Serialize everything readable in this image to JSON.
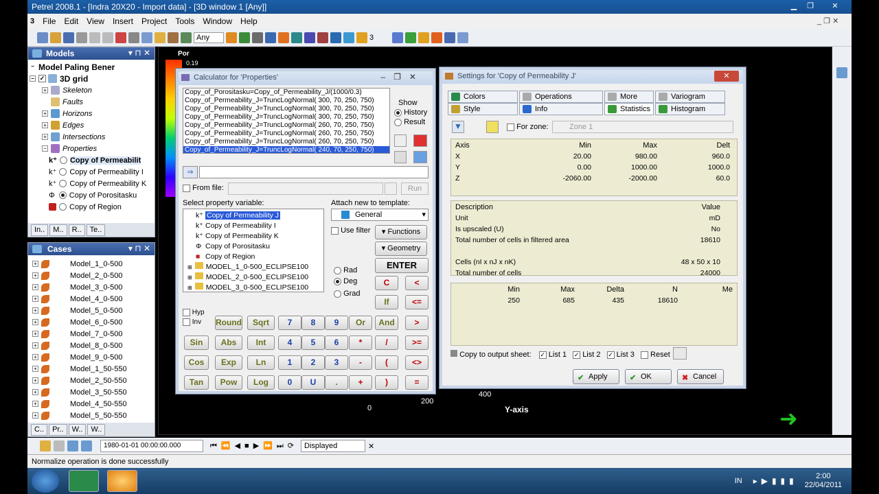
{
  "app": {
    "title": "Petrel 2008.1 - [Indra 20X20 - Import data] - [3D window 1 [Any]]"
  },
  "menu": [
    "File",
    "Edit",
    "View",
    "Insert",
    "Project",
    "Tools",
    "Window",
    "Help"
  ],
  "toolbar": {
    "combo_any": "Any",
    "number": "3"
  },
  "models": {
    "title": "Models",
    "root": "Model Paling Bener",
    "grid": "3D grid",
    "items": [
      {
        "label": "Skeleton",
        "italic": true
      },
      {
        "label": "Faults",
        "italic": true
      },
      {
        "label": "Horizons",
        "italic": true
      },
      {
        "label": "Edges",
        "italic": true
      },
      {
        "label": "Intersections",
        "italic": true
      },
      {
        "label": "Properties",
        "italic": true
      }
    ],
    "props": [
      "Copy of Permeabilit",
      "Copy of Permeability I",
      "Copy of Permeability K",
      "Copy of Porositasku",
      "Copy of Region"
    ],
    "tabs": [
      "In..",
      "M..",
      "R..",
      "Te.."
    ]
  },
  "cases": {
    "title": "Cases",
    "items": [
      "Model_1_0-500",
      "Model_2_0-500",
      "Model_3_0-500",
      "Model_4_0-500",
      "Model_5_0-500",
      "Model_6_0-500",
      "Model_7_0-500",
      "Model_8_0-500",
      "Model_9_0-500",
      "Model_1_50-550",
      "Model_2_50-550",
      "Model_3_50-550",
      "Model_4_50-550",
      "Model_5_50-550"
    ],
    "tabs": [
      "C..",
      "Pr..",
      "W..",
      "W.."
    ]
  },
  "viewport": {
    "colorbar_label": "Por",
    "colorbar_value": "0.19",
    "axis_y_label": "Y-axis",
    "tick_0": "0",
    "tick_200": "200",
    "tick_400": "400"
  },
  "calc": {
    "title": "Calculator for 'Properties'",
    "history": [
      "Copy_of_Porositasku=Copy_of_Permeability_J/(1000/0.3)",
      "Copy_of_Permeability_J=TruncLogNormal( 300, 70, 250, 750)",
      "Copy_of_Permeability_J=TruncLogNormal( 300, 70, 250, 750)",
      "Copy_of_Permeability_J=TruncLogNormal( 300, 70, 250, 750)",
      "Copy_of_Permeability_J=TruncLogNormal( 260, 70, 250, 750)",
      "Copy_of_Permeability_J=TruncLogNormal( 260, 70, 250, 750)",
      "Copy_of_Permeability_J=TruncLogNormal( 260, 70, 250, 750)",
      "Copy_of_Permeability_J=TruncLogNormal( 240, 70, 250, 750)"
    ],
    "show": "Show",
    "history_opt": "History",
    "result_opt": "Result",
    "from_file": "From file:",
    "run": "Run",
    "select_var": "Select property variable:",
    "vars": [
      "Copy of Permeability J",
      "Copy of Permeability I",
      "Copy of Permeability K",
      "Copy of Porositasku",
      "Copy of Region",
      "MODEL_1_0-500_ECLIPSE100",
      "MODEL_2_0-500_ECLIPSE100",
      "MODEL_3_0-500_ECLIPSE100"
    ],
    "attach": "Attach new to template:",
    "template": "General",
    "use_filter": "Use filter",
    "functions": "Functions",
    "geometry": "Geometry",
    "enter": "ENTER",
    "rad": "Rad",
    "deg": "Deg",
    "grad": "Grad",
    "c": "C",
    "lt": "<",
    "if": "If",
    "le": "<=",
    "hyp": "Hyp",
    "inv": "Inv",
    "row1": [
      "Round",
      "Sqrt",
      "7",
      "8",
      "9",
      "Or",
      "And",
      ">"
    ],
    "row2": [
      "Sin",
      "Abs",
      "Int",
      "4",
      "5",
      "6",
      "*",
      "/",
      ">="
    ],
    "row3": [
      "Cos",
      "Exp",
      "Ln",
      "1",
      "2",
      "3",
      "-",
      "(",
      "<>"
    ],
    "row4": [
      "Tan",
      "Pow",
      "Log",
      "0",
      "U",
      ".",
      "+",
      ")",
      "="
    ]
  },
  "settings": {
    "title": "Settings for 'Copy of Permeability J'",
    "tabs_row1": [
      "Colors",
      "Operations",
      "More",
      "Variogram"
    ],
    "tabs_row2": [
      "Style",
      "Info",
      "Statistics",
      "Histogram"
    ],
    "for_zone": "For zone:",
    "zone": "Zone 1",
    "axis_headers": [
      "Axis",
      "Min",
      "Max",
      "Delt"
    ],
    "axis_rows": [
      [
        "X",
        "20.00",
        "980.00",
        "960.0"
      ],
      [
        "Y",
        "0.00",
        "1000.00",
        "1000.0"
      ],
      [
        "Z",
        "-2060.00",
        "-2000.00",
        "60.0"
      ]
    ],
    "desc_headers": [
      "Description",
      "Value"
    ],
    "desc_rows": [
      [
        "Unit",
        "mD"
      ],
      [
        "Is upscaled (U)",
        "No"
      ],
      [
        "Total number of cells in filtered area",
        "18610"
      ],
      [
        "",
        ""
      ],
      [
        "Cells (nI x nJ x nK)",
        "48 x 50 x 10"
      ],
      [
        "Total number of cells",
        "24000"
      ]
    ],
    "stat_headers": [
      "Min",
      "Max",
      "Delta",
      "N",
      "Me"
    ],
    "stat_row": [
      "250",
      "685",
      "435",
      "18610",
      ""
    ],
    "copy_label": "Copy to output sheet:",
    "list1": "List 1",
    "list2": "List 2",
    "list3": "List 3",
    "reset": "Reset",
    "apply": "Apply",
    "ok": "OK",
    "cancel": "Cancel"
  },
  "anim": {
    "date": "1980-01-01 00:00:00.000",
    "mode": "Displayed"
  },
  "status": {
    "text": "Normalize operation is done successfully"
  },
  "taskbar": {
    "lang": "IN",
    "time": "2:00",
    "date": "22/04/2011"
  }
}
